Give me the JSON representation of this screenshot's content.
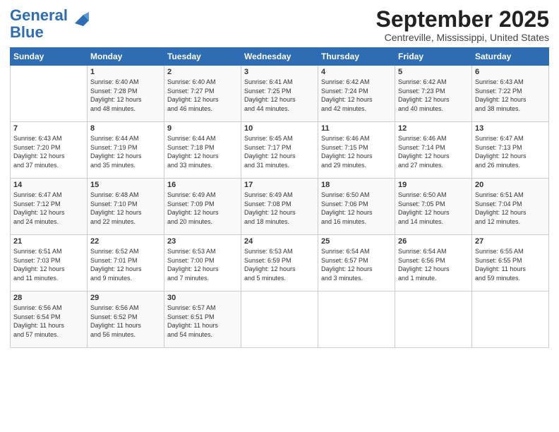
{
  "logo": {
    "line1": "General",
    "line2": "Blue"
  },
  "title": "September 2025",
  "subtitle": "Centreville, Mississippi, United States",
  "days_of_week": [
    "Sunday",
    "Monday",
    "Tuesday",
    "Wednesday",
    "Thursday",
    "Friday",
    "Saturday"
  ],
  "weeks": [
    [
      {
        "day": "",
        "info": ""
      },
      {
        "day": "1",
        "info": "Sunrise: 6:40 AM\nSunset: 7:28 PM\nDaylight: 12 hours\nand 48 minutes."
      },
      {
        "day": "2",
        "info": "Sunrise: 6:40 AM\nSunset: 7:27 PM\nDaylight: 12 hours\nand 46 minutes."
      },
      {
        "day": "3",
        "info": "Sunrise: 6:41 AM\nSunset: 7:25 PM\nDaylight: 12 hours\nand 44 minutes."
      },
      {
        "day": "4",
        "info": "Sunrise: 6:42 AM\nSunset: 7:24 PM\nDaylight: 12 hours\nand 42 minutes."
      },
      {
        "day": "5",
        "info": "Sunrise: 6:42 AM\nSunset: 7:23 PM\nDaylight: 12 hours\nand 40 minutes."
      },
      {
        "day": "6",
        "info": "Sunrise: 6:43 AM\nSunset: 7:22 PM\nDaylight: 12 hours\nand 38 minutes."
      }
    ],
    [
      {
        "day": "7",
        "info": "Sunrise: 6:43 AM\nSunset: 7:20 PM\nDaylight: 12 hours\nand 37 minutes."
      },
      {
        "day": "8",
        "info": "Sunrise: 6:44 AM\nSunset: 7:19 PM\nDaylight: 12 hours\nand 35 minutes."
      },
      {
        "day": "9",
        "info": "Sunrise: 6:44 AM\nSunset: 7:18 PM\nDaylight: 12 hours\nand 33 minutes."
      },
      {
        "day": "10",
        "info": "Sunrise: 6:45 AM\nSunset: 7:17 PM\nDaylight: 12 hours\nand 31 minutes."
      },
      {
        "day": "11",
        "info": "Sunrise: 6:46 AM\nSunset: 7:15 PM\nDaylight: 12 hours\nand 29 minutes."
      },
      {
        "day": "12",
        "info": "Sunrise: 6:46 AM\nSunset: 7:14 PM\nDaylight: 12 hours\nand 27 minutes."
      },
      {
        "day": "13",
        "info": "Sunrise: 6:47 AM\nSunset: 7:13 PM\nDaylight: 12 hours\nand 26 minutes."
      }
    ],
    [
      {
        "day": "14",
        "info": "Sunrise: 6:47 AM\nSunset: 7:12 PM\nDaylight: 12 hours\nand 24 minutes."
      },
      {
        "day": "15",
        "info": "Sunrise: 6:48 AM\nSunset: 7:10 PM\nDaylight: 12 hours\nand 22 minutes."
      },
      {
        "day": "16",
        "info": "Sunrise: 6:49 AM\nSunset: 7:09 PM\nDaylight: 12 hours\nand 20 minutes."
      },
      {
        "day": "17",
        "info": "Sunrise: 6:49 AM\nSunset: 7:08 PM\nDaylight: 12 hours\nand 18 minutes."
      },
      {
        "day": "18",
        "info": "Sunrise: 6:50 AM\nSunset: 7:06 PM\nDaylight: 12 hours\nand 16 minutes."
      },
      {
        "day": "19",
        "info": "Sunrise: 6:50 AM\nSunset: 7:05 PM\nDaylight: 12 hours\nand 14 minutes."
      },
      {
        "day": "20",
        "info": "Sunrise: 6:51 AM\nSunset: 7:04 PM\nDaylight: 12 hours\nand 12 minutes."
      }
    ],
    [
      {
        "day": "21",
        "info": "Sunrise: 6:51 AM\nSunset: 7:03 PM\nDaylight: 12 hours\nand 11 minutes."
      },
      {
        "day": "22",
        "info": "Sunrise: 6:52 AM\nSunset: 7:01 PM\nDaylight: 12 hours\nand 9 minutes."
      },
      {
        "day": "23",
        "info": "Sunrise: 6:53 AM\nSunset: 7:00 PM\nDaylight: 12 hours\nand 7 minutes."
      },
      {
        "day": "24",
        "info": "Sunrise: 6:53 AM\nSunset: 6:59 PM\nDaylight: 12 hours\nand 5 minutes."
      },
      {
        "day": "25",
        "info": "Sunrise: 6:54 AM\nSunset: 6:57 PM\nDaylight: 12 hours\nand 3 minutes."
      },
      {
        "day": "26",
        "info": "Sunrise: 6:54 AM\nSunset: 6:56 PM\nDaylight: 12 hours\nand 1 minute."
      },
      {
        "day": "27",
        "info": "Sunrise: 6:55 AM\nSunset: 6:55 PM\nDaylight: 11 hours\nand 59 minutes."
      }
    ],
    [
      {
        "day": "28",
        "info": "Sunrise: 6:56 AM\nSunset: 6:54 PM\nDaylight: 11 hours\nand 57 minutes."
      },
      {
        "day": "29",
        "info": "Sunrise: 6:56 AM\nSunset: 6:52 PM\nDaylight: 11 hours\nand 56 minutes."
      },
      {
        "day": "30",
        "info": "Sunrise: 6:57 AM\nSunset: 6:51 PM\nDaylight: 11 hours\nand 54 minutes."
      },
      {
        "day": "",
        "info": ""
      },
      {
        "day": "",
        "info": ""
      },
      {
        "day": "",
        "info": ""
      },
      {
        "day": "",
        "info": ""
      }
    ]
  ]
}
